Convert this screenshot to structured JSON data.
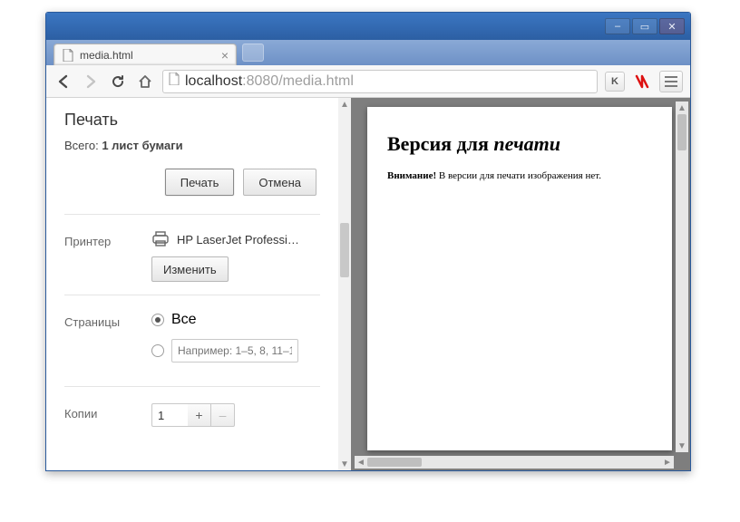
{
  "window": {
    "minimize": "–",
    "maximize": "▭",
    "close": "✕"
  },
  "tab": {
    "title": "media.html"
  },
  "address": {
    "host": "localhost",
    "port": ":8080",
    "path": "/media.html"
  },
  "extensions": {
    "k_button": "K"
  },
  "print": {
    "title": "Печать",
    "total_prefix": "Всего: ",
    "total_bold": "1 лист бумаги",
    "btn_print": "Печать",
    "btn_cancel": "Отмена",
    "printer_label": "Принтер",
    "printer_name": "HP LaserJet Professi…",
    "change_btn": "Изменить",
    "pages_label": "Страницы",
    "pages_all": "Все",
    "pages_range_placeholder": "Например: 1–5, 8, 11–1",
    "copies_label": "Копии",
    "copies_value": "1",
    "plus": "+",
    "minus": "–"
  },
  "preview": {
    "heading_normal": "Версия для ",
    "heading_italic": "печати",
    "warn_bold": "Внимание!",
    "warn_rest": " В версии для печати изображения нет."
  }
}
